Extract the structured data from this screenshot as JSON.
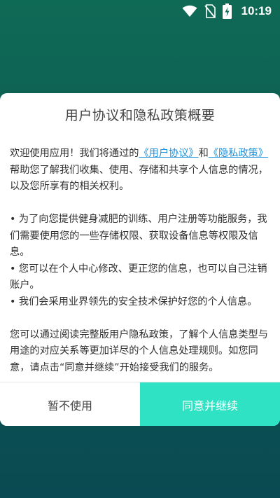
{
  "statusbar": {
    "time": "10:19",
    "icons": [
      "wifi-icon",
      "no-sim-icon",
      "battery-charging-icon"
    ]
  },
  "dialog": {
    "title": "用户协议和隐私政策概要",
    "intro_before": "欢迎使用应用！我们将通过的",
    "link_user_agreement": "《用户协议》",
    "intro_and": "和",
    "link_privacy_policy": "《隐私政策》",
    "intro_after": "帮助您了解我们收集、使用、存储和共享个人信息的情况，以及您所享有的相关权利。",
    "bullets": [
      "• 为了向您提供健身减肥的训练、用户注册等功能服务，我们需要使用您的一些存储权限、获取设备信息等权限及信息。",
      "• 您可以在个人中心修改、更正您的信息，也可以自己注销账户。",
      "• 我们会采用业界领先的安全技术保护好您的个人信息。"
    ],
    "closing": "您可以通过阅读完整版用户隐私政策，了解个人信息类型与用途的对应关系等更加详尽的个人信息处理规则。如您同意，请点击“同意并继续”开始接受我们的服务。",
    "decline_label": "暂不使用",
    "accept_label": "同意并继续"
  },
  "colors": {
    "accent": "#2fe2c4",
    "link": "#1f8fd9",
    "background_top": "#0f6a55",
    "background_bottom": "#0a4a52"
  }
}
